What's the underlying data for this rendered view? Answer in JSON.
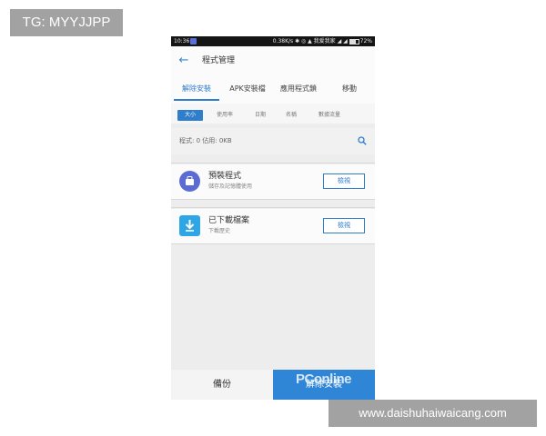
{
  "overlay": {
    "tg_badge": "TG: MYYJJPP",
    "site": "www.daishuhaiwaicang.com",
    "logo": "PConline"
  },
  "status_bar": {
    "time": "10:36",
    "right": "0.38K/s ✱ ◎ ▲ 我爱我家 ◢ ◢",
    "battery": "72%"
  },
  "header": {
    "title": "程式管理"
  },
  "tabs": [
    {
      "label": "解除安裝",
      "active": true
    },
    {
      "label": "APK安裝檔",
      "active": false
    },
    {
      "label": "應用程式鎖",
      "active": false
    },
    {
      "label": "移動",
      "active": false
    }
  ],
  "sort_options": [
    {
      "label": "大小",
      "active": true
    },
    {
      "label": "使用率",
      "active": false
    },
    {
      "label": "日期",
      "active": false
    },
    {
      "label": "名稱",
      "active": false
    },
    {
      "label": "數據流量",
      "active": false
    }
  ],
  "summary": {
    "text": "程式: 0 佔用: 0KB"
  },
  "cards": [
    {
      "name": "預裝程式",
      "sub": "儲存及記憶體使用",
      "button": "檢視",
      "icon": "android-icon",
      "color": "#5b6bd4"
    },
    {
      "name": "已下載檔案",
      "sub": "下載歷史",
      "button": "檢視",
      "icon": "download-icon",
      "color": "#2ea6e6"
    }
  ],
  "bottom": {
    "backup": "備份",
    "uninstall": "解除安裝"
  },
  "colors": {
    "accent": "#2f7ecb",
    "bottom_button": "#2f86d6"
  }
}
